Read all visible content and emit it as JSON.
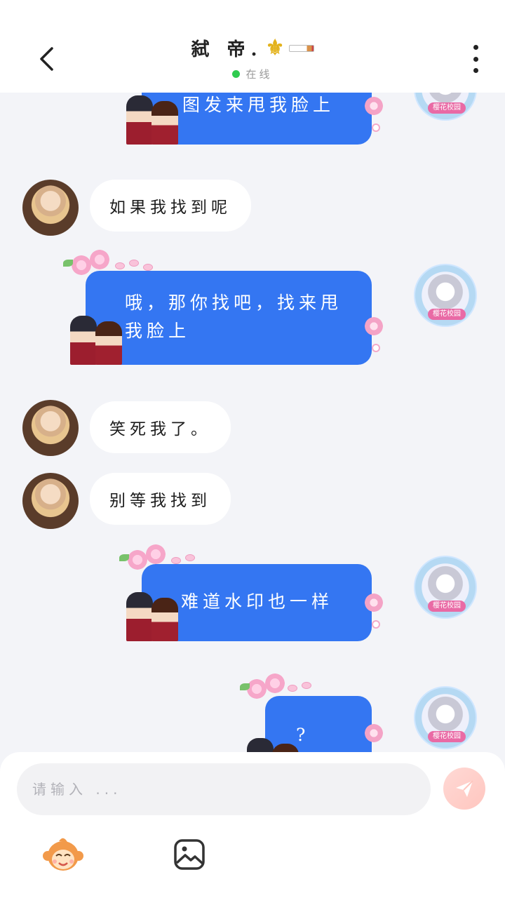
{
  "header": {
    "title": "弑 帝.",
    "title_emoji": "⚜",
    "status": "在线",
    "status_color": "#2fcb4f"
  },
  "messages": [
    {
      "side": "out",
      "text": "图发来甩我脸上",
      "avatar_tag": "樱花校园"
    },
    {
      "side": "in",
      "text": "如果我找到呢"
    },
    {
      "side": "out",
      "text_line1": "哦，那你找吧，找来甩",
      "text_line2": "我脸上",
      "avatar_tag": "樱花校园"
    },
    {
      "side": "in",
      "text": "笑死我了。"
    },
    {
      "side": "in",
      "text": "别等我找到"
    },
    {
      "side": "out",
      "text": "难道水印也一样",
      "avatar_tag": "樱花校园"
    },
    {
      "side": "out",
      "text": "?",
      "avatar_tag": "樱花校园"
    }
  ],
  "input": {
    "placeholder": "请输入 ..."
  },
  "colors": {
    "outgoing_bubble": "#3476f2",
    "incoming_bubble": "#ffffff",
    "background": "#f3f4f8",
    "send_button": "#ffc6bf"
  },
  "icons": {
    "back": "chevron-left-icon",
    "more": "more-vertical-icon",
    "send": "paper-plane-icon",
    "emoji": "monkey-emoji-icon",
    "image": "image-icon"
  }
}
